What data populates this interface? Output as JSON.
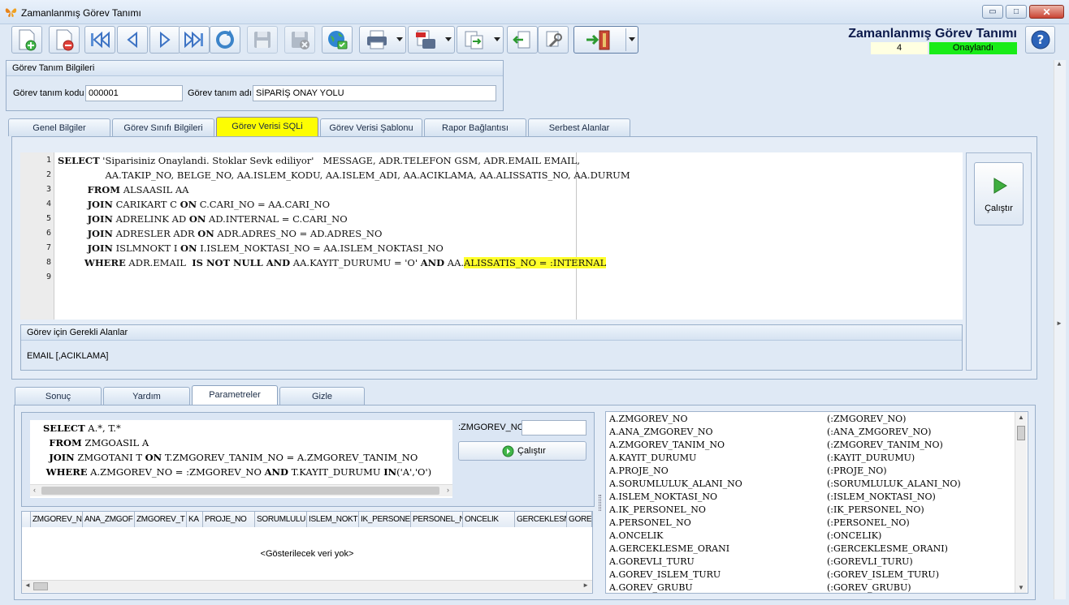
{
  "window": {
    "title": "Zamanlanmış Görev Tanımı",
    "minimize": "▭",
    "maximize": "□",
    "close": "✕"
  },
  "header": {
    "title": "Zamanlanmış Görev Tanımı",
    "count": "4",
    "status": "Onaylandı"
  },
  "colors": {
    "status_bg": "#19ec18",
    "active_tab": "#fdfd02",
    "highlight": "#ffff2a"
  },
  "toolbar_icons": [
    "new-document-icon",
    "delete-document-icon",
    "first-record-icon",
    "previous-record-icon",
    "next-record-icon",
    "last-record-icon",
    "refresh-icon",
    "save-icon",
    "cancel-save-icon",
    "web-icon",
    "print-icon",
    "pdf-export-icon",
    "export-icon",
    "import-icon",
    "tools-icon",
    "exit-icon",
    "help-icon"
  ],
  "info": {
    "title": "Görev Tanım Bilgileri",
    "code_label": "Görev tanım kodu",
    "code_value": "000001",
    "name_label": "Görev tanım adı",
    "name_value": "SİPARİŞ ONAY YOLU"
  },
  "tabs": [
    "Genel Bilgiler",
    "Görev Sınıfı Bilgileri",
    "Görev Verisi SQLi",
    "Görev Verisi Şablonu",
    "Rapor Bağlantısı",
    "Serbest Alanlar"
  ],
  "editor": {
    "line_numbers": [
      "1",
      "2",
      "3",
      "4",
      "5",
      "6",
      "7",
      "8",
      "9"
    ],
    "run_label": "Çalıştır"
  },
  "required": {
    "title": "Görev için Gerekli Alanlar",
    "value": "EMAIL [,ACIKLAMA]"
  },
  "subtabs": [
    "Sonuç",
    "Yardım",
    "Parametreler",
    "Gizle"
  ],
  "params": {
    "field_label": ":ZMGOREV_NO",
    "field_value": "",
    "run_label": "Çalıştır",
    "empty_text": "<Gösterilecek veri yok>"
  },
  "grid_columns": [
    "ZMGOREV_N",
    "ANA_ZMGOF",
    "ZMGOREV_T",
    "KA",
    "PROJE_NO",
    "SORUMLULU",
    "ISLEM_NOKT",
    "IK_PERSONE",
    "PERSONEL_N",
    "ONCELIK",
    "GERCEKLESM",
    "GOREV"
  ],
  "param_list": [
    [
      "A.ZMGOREV_NO",
      "(:ZMGOREV_NO)"
    ],
    [
      "A.ANA_ZMGOREV_NO",
      "(:ANA_ZMGOREV_NO)"
    ],
    [
      "A.ZMGOREV_TANIM_NO",
      "(:ZMGOREV_TANIM_NO)"
    ],
    [
      "A.KAYIT_DURUMU",
      "(:KAYIT_DURUMU)"
    ],
    [
      "A.PROJE_NO",
      "(:PROJE_NO)"
    ],
    [
      "A.SORUMLULUK_ALANI_NO",
      "(:SORUMLULUK_ALANI_NO)"
    ],
    [
      "A.ISLEM_NOKTASI_NO",
      "(:ISLEM_NOKTASI_NO)"
    ],
    [
      "A.IK_PERSONEL_NO",
      "(:IK_PERSONEL_NO)"
    ],
    [
      "A.PERSONEL_NO",
      "(:PERSONEL_NO)"
    ],
    [
      "A.ONCELIK",
      "(:ONCELIK)"
    ],
    [
      "A.GERCEKLESME_ORANI",
      "(:GERCEKLESME_ORANI)"
    ],
    [
      "A.GOREVLI_TURU",
      "(:GOREVLI_TURU)"
    ],
    [
      "A.GOREV_ISLEM_TURU",
      "(:GOREV_ISLEM_TURU)"
    ],
    [
      "A.GOREV_GRUBU",
      "(:GOREV_GRUBU)"
    ]
  ]
}
